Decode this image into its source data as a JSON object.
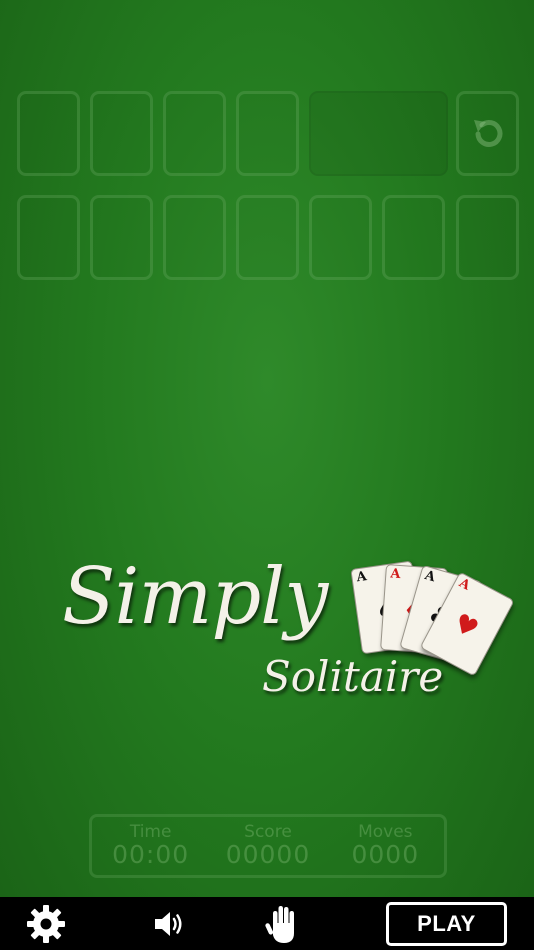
{
  "board": {
    "foundations": [
      "",
      "",
      "",
      ""
    ],
    "tableau": [
      "",
      "",
      "",
      "",
      "",
      "",
      ""
    ]
  },
  "logo": {
    "line1": "Simply",
    "line2": "Solitaire",
    "cards": [
      {
        "rank": "A",
        "suit": "♠",
        "color": "#111111"
      },
      {
        "rank": "A",
        "suit": "♦",
        "color": "#d01b1b"
      },
      {
        "rank": "A",
        "suit": "♣",
        "color": "#111111"
      },
      {
        "rank": "A",
        "suit": "♥",
        "color": "#d01b1b"
      }
    ]
  },
  "stats": {
    "time_label": "Time",
    "time_value": "00:00",
    "score_label": "Score",
    "score_value": "00000",
    "moves_label": "Moves",
    "moves_value": "0000"
  },
  "toolbar": {
    "settings_icon": "gear-icon",
    "sound_icon": "speaker-icon",
    "hint_icon": "hand-icon",
    "play_label": "PLAY"
  },
  "colors": {
    "felt": "#237a1f",
    "bar": "#000000",
    "text": "#ffffff"
  }
}
